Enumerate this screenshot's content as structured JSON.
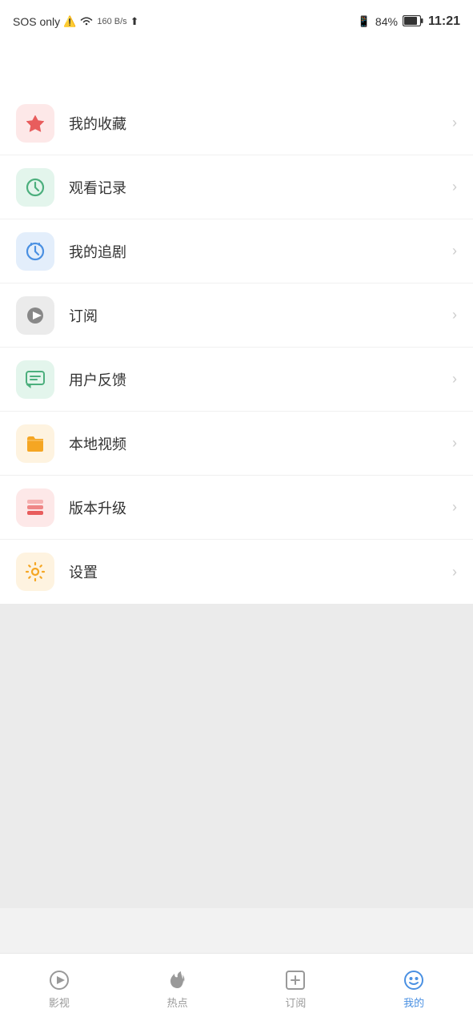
{
  "statusBar": {
    "left": "SOS only",
    "network": "160 B/s",
    "battery": "84%",
    "time": "11:21"
  },
  "menuItems": [
    {
      "id": "favorites",
      "label": "我的收藏",
      "iconColor": "#e85d5d",
      "iconBg": "#fde8e8",
      "iconType": "star"
    },
    {
      "id": "history",
      "label": "观看记录",
      "iconColor": "#4caf7d",
      "iconBg": "#e3f5ec",
      "iconType": "clock"
    },
    {
      "id": "following",
      "label": "我的追剧",
      "iconColor": "#4a90e2",
      "iconBg": "#e3eefb",
      "iconType": "alarm"
    },
    {
      "id": "subscribe",
      "label": "订阅",
      "iconColor": "#888",
      "iconBg": "#ebebeb",
      "iconType": "play"
    },
    {
      "id": "feedback",
      "label": "用户反馈",
      "iconColor": "#4caf7d",
      "iconBg": "#e3f5ec",
      "iconType": "chat"
    },
    {
      "id": "local",
      "label": "本地视频",
      "iconColor": "#f5a623",
      "iconBg": "#fef3e0",
      "iconType": "folder"
    },
    {
      "id": "update",
      "label": "版本升级",
      "iconColor": "#e85d5d",
      "iconBg": "#fde8e8",
      "iconType": "layers"
    },
    {
      "id": "settings",
      "label": "设置",
      "iconColor": "#f5a623",
      "iconBg": "#fef3e0",
      "iconType": "gear"
    }
  ],
  "bottomNav": [
    {
      "id": "movies",
      "label": "影视",
      "iconType": "play-circle",
      "active": false
    },
    {
      "id": "hot",
      "label": "热点",
      "iconType": "fire",
      "active": false
    },
    {
      "id": "subscribe",
      "label": "订阅",
      "iconType": "plus-square",
      "active": false
    },
    {
      "id": "mine",
      "label": "我的",
      "iconType": "smile",
      "active": true
    }
  ]
}
